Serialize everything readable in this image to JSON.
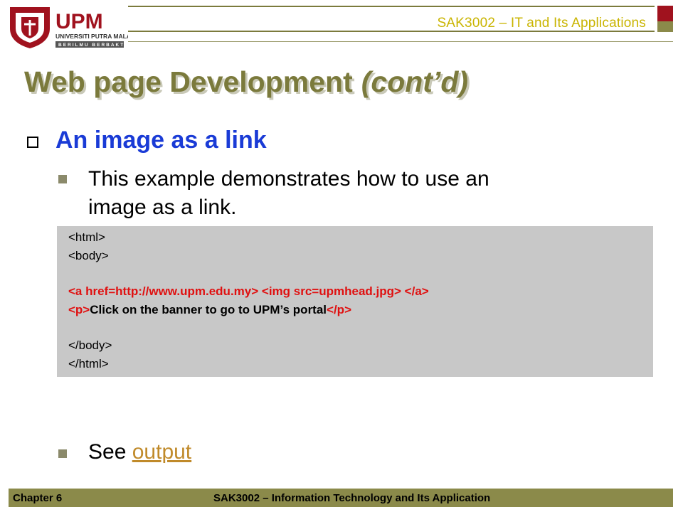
{
  "header": {
    "logo_text": "UPM",
    "logo_subtitle": "UNIVERSITI PUTRA MALAYSIA",
    "logo_motto": "BERILMU BERBAKTI",
    "course": "SAK3002 – IT and Its Applications",
    "colors": {
      "accent": "#7b7a3c",
      "red": "#a0121e",
      "gold": "#c9b400"
    }
  },
  "slide": {
    "title": "Web page Development",
    "title_suffix": "(cont’d)",
    "bullet1": "An image as a link",
    "bullet2_line1": "This example demonstrates how to use an",
    "bullet2_line2": "image as a link.",
    "code": {
      "html_open": "<html>",
      "body_open": "<body>",
      "a_open": "<a href=http://www.upm.edu.my>",
      "img_tag": "<img src=upmhead.jpg>",
      "a_close": "</a>",
      "p_open": "<p>",
      "p_text": "Click on the banner to go to UPM’s portal",
      "p_close": "</p>",
      "body_close": "</body>",
      "html_close": "</html>"
    },
    "see_label": "See",
    "output_link": "output"
  },
  "footer": {
    "chapter": "Chapter 6",
    "course": "SAK3002 – Information Technology and Its Application"
  }
}
